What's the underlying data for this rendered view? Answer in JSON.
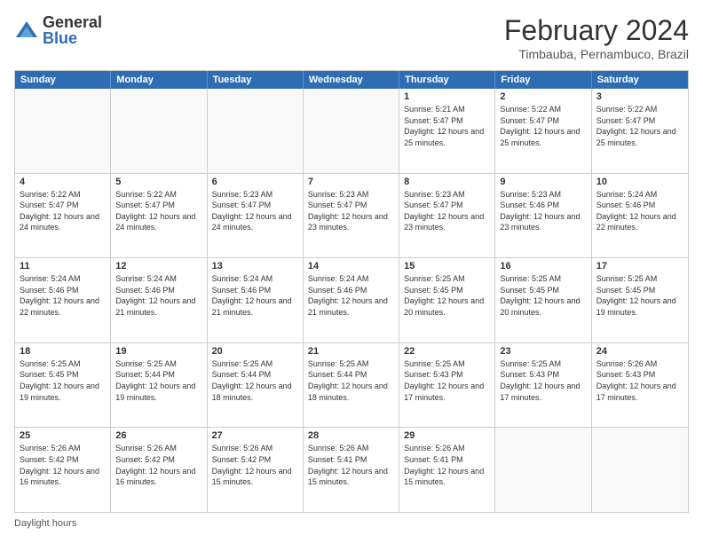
{
  "logo": {
    "general": "General",
    "blue": "Blue"
  },
  "header": {
    "month": "February 2024",
    "location": "Timbauba, Pernambuco, Brazil"
  },
  "days": [
    "Sunday",
    "Monday",
    "Tuesday",
    "Wednesday",
    "Thursday",
    "Friday",
    "Saturday"
  ],
  "footer": "Daylight hours",
  "weeks": [
    [
      {
        "day": "",
        "info": ""
      },
      {
        "day": "",
        "info": ""
      },
      {
        "day": "",
        "info": ""
      },
      {
        "day": "",
        "info": ""
      },
      {
        "day": "1",
        "info": "Sunrise: 5:21 AM\nSunset: 5:47 PM\nDaylight: 12 hours\nand 25 minutes."
      },
      {
        "day": "2",
        "info": "Sunrise: 5:22 AM\nSunset: 5:47 PM\nDaylight: 12 hours\nand 25 minutes."
      },
      {
        "day": "3",
        "info": "Sunrise: 5:22 AM\nSunset: 5:47 PM\nDaylight: 12 hours\nand 25 minutes."
      }
    ],
    [
      {
        "day": "4",
        "info": "Sunrise: 5:22 AM\nSunset: 5:47 PM\nDaylight: 12 hours\nand 24 minutes."
      },
      {
        "day": "5",
        "info": "Sunrise: 5:22 AM\nSunset: 5:47 PM\nDaylight: 12 hours\nand 24 minutes."
      },
      {
        "day": "6",
        "info": "Sunrise: 5:23 AM\nSunset: 5:47 PM\nDaylight: 12 hours\nand 24 minutes."
      },
      {
        "day": "7",
        "info": "Sunrise: 5:23 AM\nSunset: 5:47 PM\nDaylight: 12 hours\nand 23 minutes."
      },
      {
        "day": "8",
        "info": "Sunrise: 5:23 AM\nSunset: 5:47 PM\nDaylight: 12 hours\nand 23 minutes."
      },
      {
        "day": "9",
        "info": "Sunrise: 5:23 AM\nSunset: 5:46 PM\nDaylight: 12 hours\nand 23 minutes."
      },
      {
        "day": "10",
        "info": "Sunrise: 5:24 AM\nSunset: 5:46 PM\nDaylight: 12 hours\nand 22 minutes."
      }
    ],
    [
      {
        "day": "11",
        "info": "Sunrise: 5:24 AM\nSunset: 5:46 PM\nDaylight: 12 hours\nand 22 minutes."
      },
      {
        "day": "12",
        "info": "Sunrise: 5:24 AM\nSunset: 5:46 PM\nDaylight: 12 hours\nand 21 minutes."
      },
      {
        "day": "13",
        "info": "Sunrise: 5:24 AM\nSunset: 5:46 PM\nDaylight: 12 hours\nand 21 minutes."
      },
      {
        "day": "14",
        "info": "Sunrise: 5:24 AM\nSunset: 5:46 PM\nDaylight: 12 hours\nand 21 minutes."
      },
      {
        "day": "15",
        "info": "Sunrise: 5:25 AM\nSunset: 5:45 PM\nDaylight: 12 hours\nand 20 minutes."
      },
      {
        "day": "16",
        "info": "Sunrise: 5:25 AM\nSunset: 5:45 PM\nDaylight: 12 hours\nand 20 minutes."
      },
      {
        "day": "17",
        "info": "Sunrise: 5:25 AM\nSunset: 5:45 PM\nDaylight: 12 hours\nand 19 minutes."
      }
    ],
    [
      {
        "day": "18",
        "info": "Sunrise: 5:25 AM\nSunset: 5:45 PM\nDaylight: 12 hours\nand 19 minutes."
      },
      {
        "day": "19",
        "info": "Sunrise: 5:25 AM\nSunset: 5:44 PM\nDaylight: 12 hours\nand 19 minutes."
      },
      {
        "day": "20",
        "info": "Sunrise: 5:25 AM\nSunset: 5:44 PM\nDaylight: 12 hours\nand 18 minutes."
      },
      {
        "day": "21",
        "info": "Sunrise: 5:25 AM\nSunset: 5:44 PM\nDaylight: 12 hours\nand 18 minutes."
      },
      {
        "day": "22",
        "info": "Sunrise: 5:25 AM\nSunset: 5:43 PM\nDaylight: 12 hours\nand 17 minutes."
      },
      {
        "day": "23",
        "info": "Sunrise: 5:25 AM\nSunset: 5:43 PM\nDaylight: 12 hours\nand 17 minutes."
      },
      {
        "day": "24",
        "info": "Sunrise: 5:26 AM\nSunset: 5:43 PM\nDaylight: 12 hours\nand 17 minutes."
      }
    ],
    [
      {
        "day": "25",
        "info": "Sunrise: 5:26 AM\nSunset: 5:42 PM\nDaylight: 12 hours\nand 16 minutes."
      },
      {
        "day": "26",
        "info": "Sunrise: 5:26 AM\nSunset: 5:42 PM\nDaylight: 12 hours\nand 16 minutes."
      },
      {
        "day": "27",
        "info": "Sunrise: 5:26 AM\nSunset: 5:42 PM\nDaylight: 12 hours\nand 15 minutes."
      },
      {
        "day": "28",
        "info": "Sunrise: 5:26 AM\nSunset: 5:41 PM\nDaylight: 12 hours\nand 15 minutes."
      },
      {
        "day": "29",
        "info": "Sunrise: 5:26 AM\nSunset: 5:41 PM\nDaylight: 12 hours\nand 15 minutes."
      },
      {
        "day": "",
        "info": ""
      },
      {
        "day": "",
        "info": ""
      }
    ]
  ]
}
